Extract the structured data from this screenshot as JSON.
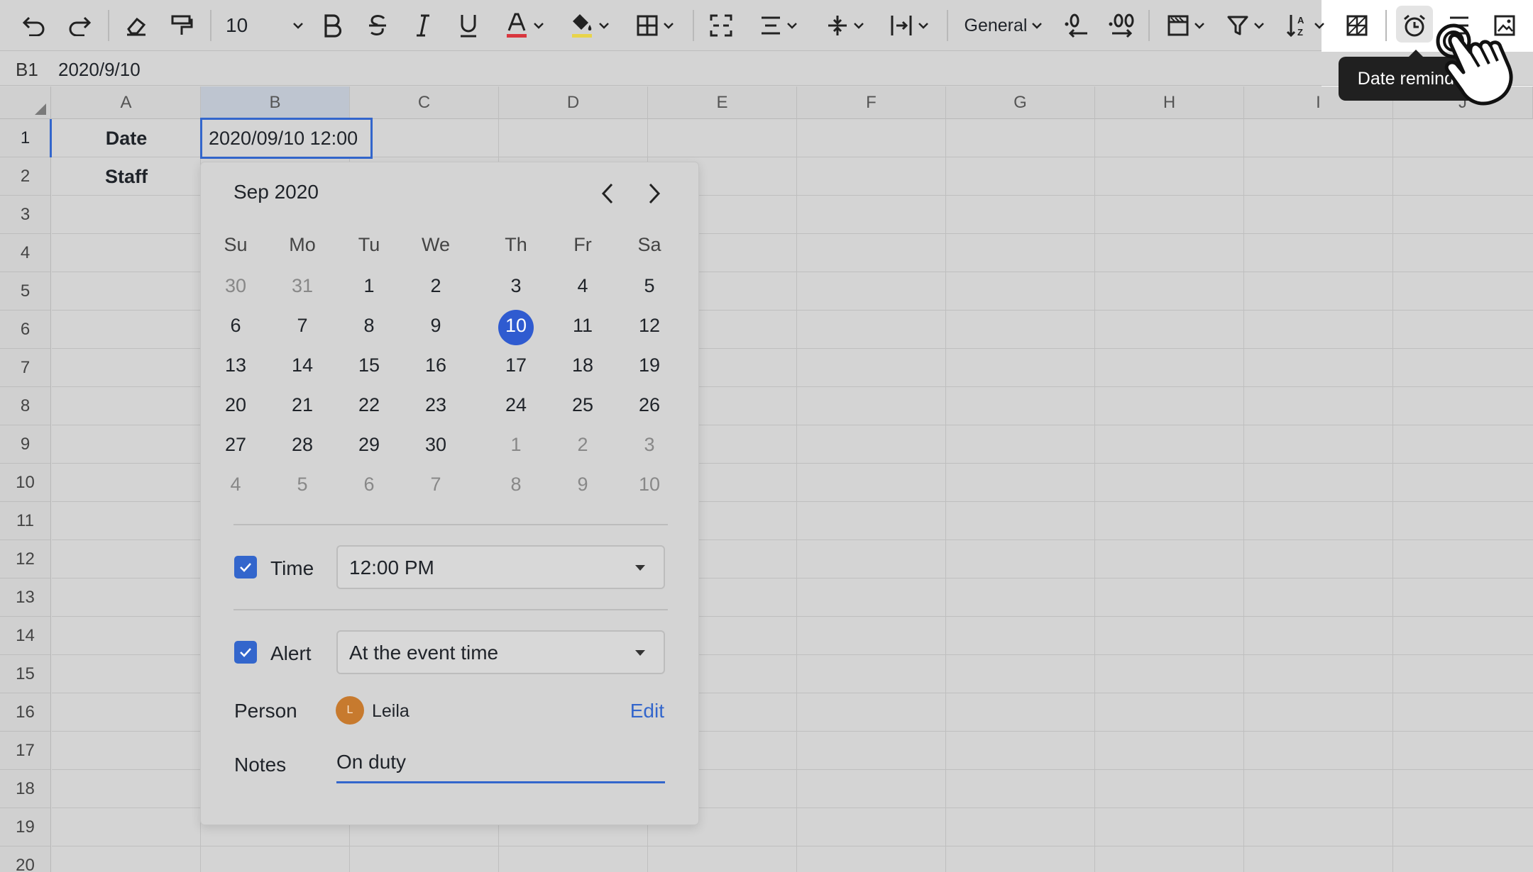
{
  "toolbar": {
    "font_size": "10",
    "number_format": "General",
    "tooltip": "Date reminder"
  },
  "formula_bar": {
    "cell_ref": "B1",
    "value": "2020/9/10"
  },
  "columns": [
    "A",
    "B",
    "C",
    "D",
    "E",
    "F",
    "G",
    "H",
    "I",
    "J"
  ],
  "rows": [
    "1",
    "2",
    "3",
    "4",
    "5",
    "6",
    "7",
    "8",
    "9",
    "10",
    "11",
    "12",
    "13",
    "14",
    "15",
    "16",
    "17",
    "18",
    "19",
    "20"
  ],
  "cells": {
    "a1": "Date",
    "a2": "Staff",
    "b1": "2020/09/10 12:00"
  },
  "calendar": {
    "title": "Sep 2020",
    "weekdays": [
      "Su",
      "Mo",
      "Tu",
      "We",
      "Th",
      "Fr",
      "Sa"
    ],
    "weeks": [
      [
        "30",
        "31",
        "1",
        "2",
        "3",
        "4",
        "5"
      ],
      [
        "6",
        "7",
        "8",
        "9",
        "10",
        "11",
        "12"
      ],
      [
        "13",
        "14",
        "15",
        "16",
        "17",
        "18",
        "19"
      ],
      [
        "20",
        "21",
        "22",
        "23",
        "24",
        "25",
        "26"
      ],
      [
        "27",
        "28",
        "29",
        "30",
        "1",
        "2",
        "3"
      ],
      [
        "4",
        "5",
        "6",
        "7",
        "8",
        "9",
        "10"
      ]
    ],
    "selected_day": "10",
    "time_label": "Time",
    "time_value": "12:00 PM",
    "alert_label": "Alert",
    "alert_value": "At the event time",
    "person_label": "Person",
    "person_initial": "L",
    "person_name": "Leila",
    "edit_label": "Edit",
    "notes_label": "Notes",
    "notes_value": "On duty"
  },
  "colors": {
    "accent": "#3366cc",
    "selected_day": "#2f5bd0",
    "avatar": "#c77a2e"
  }
}
